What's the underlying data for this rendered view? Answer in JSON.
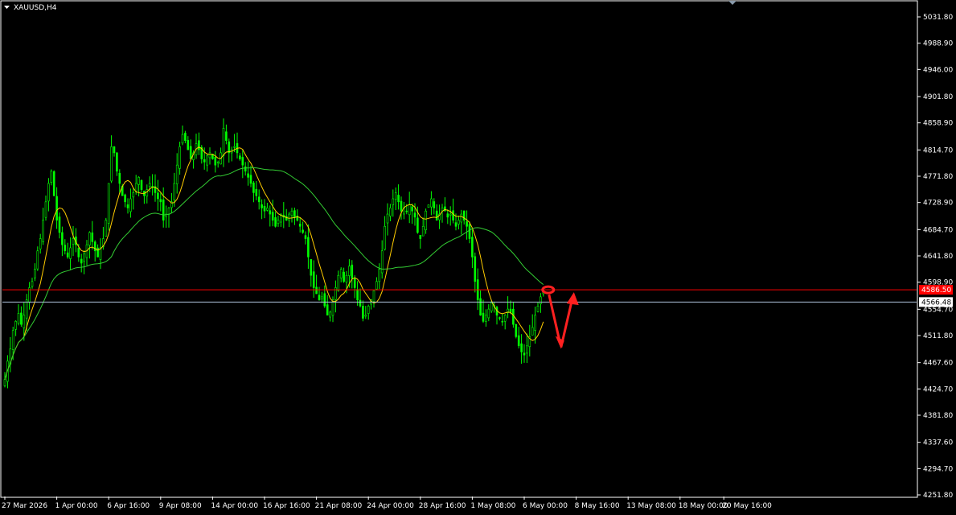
{
  "window": {
    "symbol_title": "XAUUSD,H4",
    "menu_icon": "triangle-down-icon"
  },
  "colors": {
    "background": "#000000",
    "bull_candle": "#00ff00",
    "bear_candle": "#00ff00",
    "ma_fast": "#ffcc00",
    "ma_slow": "#33cc33",
    "frame": "#ffffff",
    "resistance_line": "#ff0000",
    "bid_line": "#b0c4de",
    "annotation": "#ff2020"
  },
  "chart_data": {
    "type": "candlestick",
    "symbol": "XAUUSD",
    "timeframe": "H4",
    "ylim": [
      4251.8,
      5031.8
    ],
    "y_ticks": [
      5031.8,
      4988.9,
      4946.0,
      4901.8,
      4858.9,
      4814.7,
      4771.8,
      4728.9,
      4684.7,
      4641.8,
      4598.9,
      4554.7,
      4511.8,
      4467.6,
      4424.7,
      4381.8,
      4337.6,
      4294.7,
      4251.8
    ],
    "y_tick_labels": [
      "5031.80",
      "4988.90",
      "4946.00",
      "4901.80",
      "4858.90",
      "4814.70",
      "4771.80",
      "4728.90",
      "4684.70",
      "4641.80",
      "4598.90",
      "4554.70",
      "4511.80",
      "4467.60",
      "4424.70",
      "4381.80",
      "4337.60",
      "4294.70",
      "4251.80"
    ],
    "x_tick_labels": [
      "27 Mar 2026",
      "1 Apr 00:00",
      "6 Apr 16:00",
      "9 Apr 08:00",
      "14 Apr 00:00",
      "16 Apr 16:00",
      "21 Apr 08:00",
      "24 Apr 00:00",
      "28 Apr 16:00",
      "1 May 08:00",
      "6 May 00:00",
      "8 May 16:00",
      "13 May 08:00",
      "18 May 00:00",
      "20 May 16:00"
    ],
    "x_tick_bar_index": [
      0,
      19,
      38,
      57,
      76,
      95,
      114,
      133,
      152,
      171,
      190,
      209,
      228,
      247,
      263
    ],
    "closes": [
      4440,
      4470,
      4490,
      4520,
      4535,
      4548,
      4530,
      4545,
      4570,
      4590,
      4600,
      4620,
      4650,
      4670,
      4700,
      4730,
      4760,
      4780,
      4740,
      4700,
      4680,
      4660,
      4650,
      4640,
      4655,
      4670,
      4660,
      4640,
      4630,
      4645,
      4660,
      4680,
      4665,
      4650,
      4640,
      4655,
      4670,
      4700,
      4760,
      4820,
      4810,
      4780,
      4760,
      4740,
      4730,
      4720,
      4735,
      4745,
      4760,
      4770,
      4750,
      4740,
      4750,
      4760,
      4755,
      4745,
      4735,
      4730,
      4700,
      4710,
      4720,
      4730,
      4760,
      4790,
      4820,
      4840,
      4830,
      4815,
      4800,
      4810,
      4825,
      4815,
      4800,
      4795,
      4805,
      4810,
      4800,
      4790,
      4795,
      4810,
      4850,
      4830,
      4810,
      4815,
      4820,
      4810,
      4800,
      4790,
      4780,
      4770,
      4760,
      4745,
      4740,
      4730,
      4720,
      4715,
      4720,
      4710,
      4700,
      4690,
      4700,
      4710,
      4705,
      4700,
      4710,
      4715,
      4705,
      4700,
      4690,
      4680,
      4670,
      4640,
      4610,
      4590,
      4580,
      4570,
      4575,
      4560,
      4545,
      4550,
      4570,
      4590,
      4610,
      4620,
      4600,
      4610,
      4625,
      4605,
      4590,
      4570,
      4560,
      4540,
      4545,
      4560,
      4570,
      4585,
      4600,
      4620,
      4650,
      4690,
      4710,
      4720,
      4735,
      4745,
      4730,
      4715,
      4720,
      4715,
      4725,
      4715,
      4705,
      4680,
      4670,
      4690,
      4715,
      4725,
      4735,
      4720,
      4700,
      4710,
      4720,
      4715,
      4705,
      4710,
      4700,
      4690,
      4700,
      4710,
      4700,
      4690,
      4670,
      4640,
      4600,
      4570,
      4545,
      4535,
      4545,
      4555,
      4565,
      4560,
      4545,
      4540,
      4535,
      4545,
      4555,
      4550,
      4530,
      4510,
      4495,
      4485,
      4480,
      4495,
      4510,
      4525,
      4545,
      4560,
      4575,
      4585
    ],
    "annotations": [
      {
        "type": "horizontal_line",
        "price": 4586.5,
        "label": "4586.50",
        "color": "#ff0000"
      },
      {
        "type": "horizontal_line",
        "price": 4566.48,
        "label": "4566.48",
        "color": "#b0c4de"
      },
      {
        "type": "ellipse_marker",
        "color": "#ff2020"
      },
      {
        "type": "projected_path_arrow",
        "color": "#ff2020"
      }
    ]
  }
}
